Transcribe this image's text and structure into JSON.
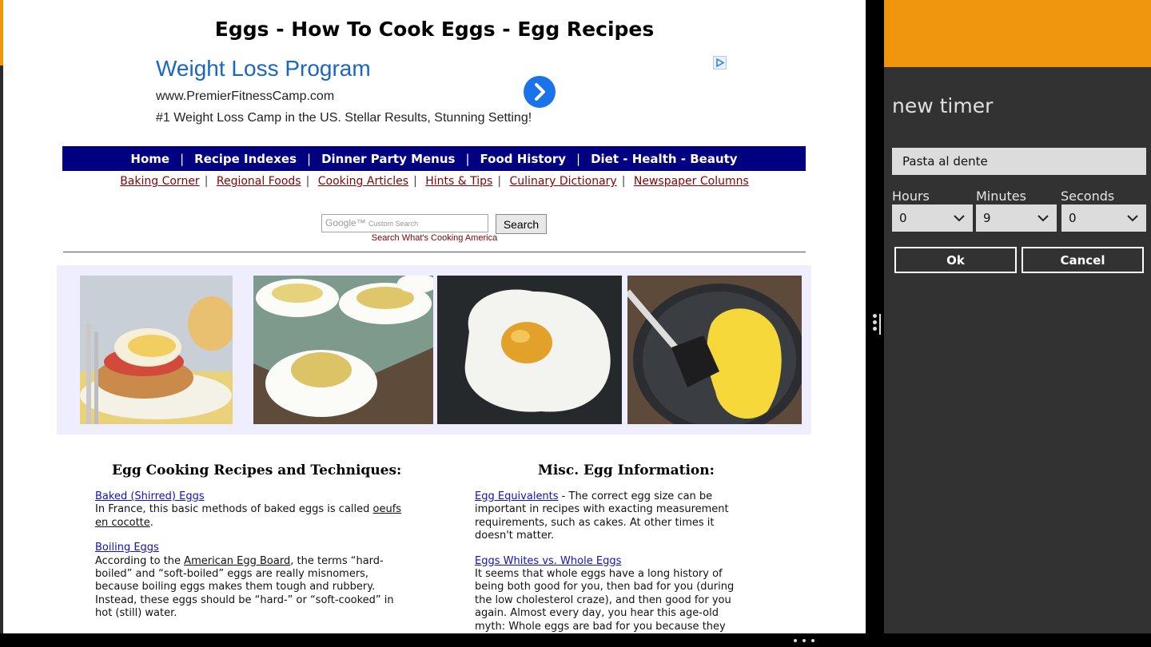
{
  "page": {
    "title": "Eggs - How To Cook Eggs - Egg Recipes",
    "ad": {
      "title": "Weight Loss Program",
      "url": "www.PremierFitnessCamp.com",
      "description": "#1 Weight Loss Camp in the US. Stellar Results, Stunning Setting!",
      "arrow_icon": "chevron-right-icon",
      "adchoices_icon": "adchoices-icon"
    },
    "nav": [
      "Home",
      "Recipe Indexes",
      "Dinner Party Menus",
      "Food History",
      "Diet - Health - Beauty"
    ],
    "nav_separator": "|",
    "subnav": [
      "Baking Corner",
      "Regional Foods",
      "Cooking Articles",
      "Hints & Tips",
      "Culinary Dictionary",
      "Newspaper Columns"
    ],
    "search": {
      "placeholder_brand": "Google",
      "placeholder_text": "Custom Search",
      "button": "Search",
      "caption": "Search What's Cooking America"
    },
    "photos": [
      "eggs-benedict-photo",
      "deviled-eggs-photo",
      "fried-egg-photo",
      "scrambled-eggs-photo"
    ],
    "left_column": {
      "title": "Egg Cooking Recipes and Techniques:",
      "items": [
        {
          "link": "Baked (Shirred) Eggs",
          "text_before": "In France, this basic methods of baked eggs is called ",
          "inline_link": "oeufs en cocotte",
          "text_after": "."
        },
        {
          "link": "Boiling Eggs",
          "text_before": "According to the ",
          "inline_link": "American Egg Board",
          "text_after": ", the terms “hard-boiled” and “soft-boiled” eggs are really misnomers, because boiling eggs makes them tough and rubbery. Instead, these eggs should be “hard-” or “soft-cooked” in hot (still) water."
        }
      ]
    },
    "right_column": {
      "title": "Misc. Egg Information:",
      "items": [
        {
          "link": "Egg Equivalents",
          "inline_text": " - The correct egg size can be important in recipes with exacting measurement requirements, such as cakes. At other times it doesn't matter.",
          "text": ""
        },
        {
          "link": "Eggs Whites vs. Whole Eggs",
          "inline_text": "",
          "text": "It seems that whole eggs have a long history of being both good for you, then bad for you (during the low cholesterol craze), and then good for you again. Almost every day, you hear this age-old myth: Whole eggs are bad for you because they"
        }
      ]
    }
  },
  "timer_panel": {
    "title": "new timer",
    "name_value": "Pasta al dente",
    "labels": {
      "hours": "Hours",
      "minutes": "Minutes",
      "seconds": "Seconds"
    },
    "values": {
      "hours": "0",
      "minutes": "9",
      "seconds": "0"
    },
    "ok": "Ok",
    "cancel": "Cancel",
    "accent": "#f0960e",
    "background": "#323232"
  },
  "app_bar": {
    "more_icon": "more-icon"
  }
}
